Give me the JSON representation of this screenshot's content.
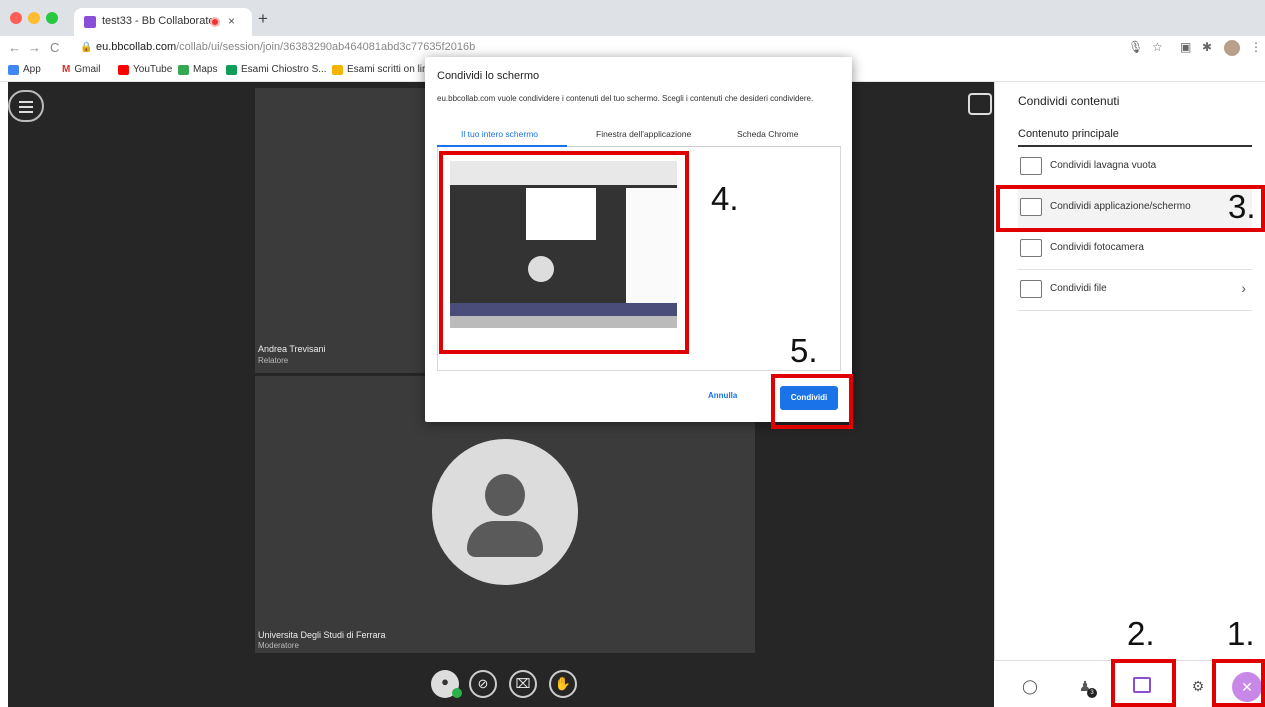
{
  "browser": {
    "tab_title": "test33 - Bb Collaborate",
    "tab_close": "×",
    "new_tab": "+",
    "url_host": "eu.bbcollab.com",
    "url_path": "/collab/ui/session/join/36383290ab464081abd3c77635f2016b",
    "bookmarks": [
      "App",
      "Gmail",
      "YouTube",
      "Maps",
      "Esami Chiostro S...",
      "Esami scritti on lin..."
    ]
  },
  "participants": [
    {
      "name": "Andrea Trevisani",
      "role": "Relatore"
    },
    {
      "name": "Universita Degli Studi di Ferrara",
      "role": "Moderatore"
    }
  ],
  "dialog": {
    "title": "Condividi lo schermo",
    "description": "eu.bbcollab.com vuole condividere i contenuti del tuo schermo. Scegli i contenuti che desideri condividere.",
    "tabs": [
      "Il tuo intero schermo",
      "Finestra dell'applicazione",
      "Scheda Chrome"
    ],
    "cancel": "Annulla",
    "share": "Condividi"
  },
  "panel": {
    "title": "Condividi contenuti",
    "section": "Contenuto principale",
    "items": [
      {
        "label": "Condividi lavagna vuota",
        "icon": "whiteboard-icon"
      },
      {
        "label": "Condividi applicazione/schermo",
        "icon": "screen-share-icon"
      },
      {
        "label": "Condividi fotocamera",
        "icon": "camera-icon"
      },
      {
        "label": "Condividi file",
        "icon": "file-icon"
      }
    ],
    "chevron": "›",
    "attendee_count": "3"
  },
  "annotations": {
    "one": "1.",
    "two": "2.",
    "three": "3.",
    "four": "4.",
    "five": "5."
  },
  "colors": {
    "accent": "#1a73e8",
    "brand": "#8a4fd8",
    "annotation": "#e00000",
    "stage": "#262626"
  }
}
